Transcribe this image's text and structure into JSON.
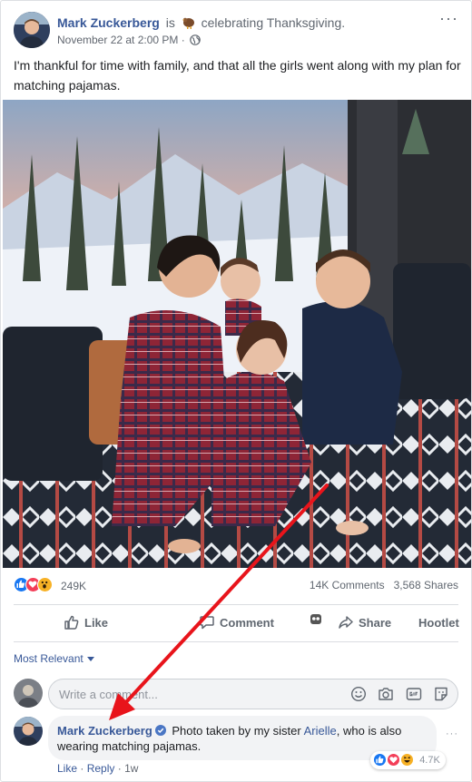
{
  "post": {
    "author": "Mark Zuckerberg",
    "is_text": "is",
    "activity": "celebrating Thanksgiving.",
    "timestamp": "November 22 at 2:00 PM",
    "separator": "·",
    "more": "···",
    "text": "I'm thankful for time with family, and that all the girls went along with my plan for matching pajamas."
  },
  "stats": {
    "reactions_count": "249K",
    "comments": "14K Comments",
    "shares": "3,568 Shares",
    "reaction_icons": [
      "like-icon",
      "love-icon",
      "wow-icon"
    ]
  },
  "actions": {
    "like": "Like",
    "comment": "Comment",
    "share": "Share",
    "hootlet": "Hootlet"
  },
  "comments_section": {
    "sort_label": "Most Relevant",
    "composer_placeholder": "Write a comment...",
    "composer_icons": [
      "emoji-icon",
      "camera-icon",
      "gif-icon",
      "sticker-icon"
    ]
  },
  "comment": {
    "author": "Mark Zuckerberg",
    "text_before": "Photo taken by my sister",
    "mention": "Arielle",
    "text_after": ", who is also wearing matching pajamas.",
    "reactions_count": "4.7K",
    "like_label": "Like",
    "reply_label": "Reply",
    "age": "1w",
    "dot": "·",
    "more": "···"
  },
  "colors": {
    "link_blue": "#385898",
    "like_blue": "#1877f2",
    "love_red": "#f33e58",
    "wow_yellow": "#f7b125",
    "annotation_arrow": "#e8141b"
  }
}
